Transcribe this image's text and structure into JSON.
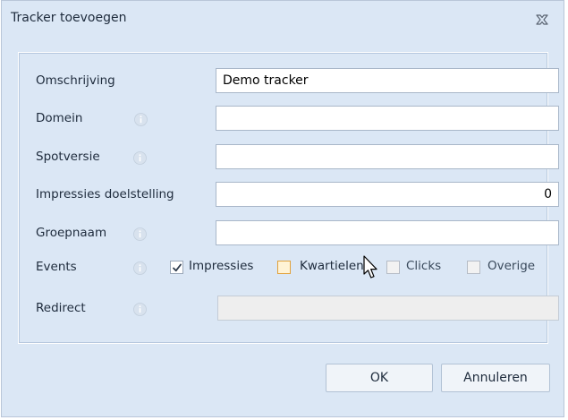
{
  "dialog": {
    "title": "Tracker toevoegen"
  },
  "fields": {
    "description": {
      "label": "Omschrijving",
      "value": "Demo tracker"
    },
    "domain": {
      "label": "Domein",
      "value": ""
    },
    "spot_version": {
      "label": "Spotversie",
      "value": ""
    },
    "impressions_goal": {
      "label": "Impressies doelstelling",
      "value": "0"
    },
    "group_name": {
      "label": "Groepnaam",
      "value": ""
    },
    "events": {
      "label": "Events"
    },
    "redirect": {
      "label": "Redirect",
      "value": ""
    }
  },
  "events": {
    "impressions": {
      "label": "Impressies",
      "checked": true
    },
    "quartiles": {
      "label": "Kwartielen",
      "checked": false
    },
    "clicks": {
      "label": "Clicks",
      "checked": false
    },
    "other": {
      "label": "Overige",
      "checked": false
    }
  },
  "buttons": {
    "ok": "OK",
    "cancel": "Annuleren"
  },
  "colors": {
    "dialog_background": "#dbe7f5",
    "info_icon": "#d8e2ee",
    "checkbox_hover_border": "#e1a23c"
  }
}
